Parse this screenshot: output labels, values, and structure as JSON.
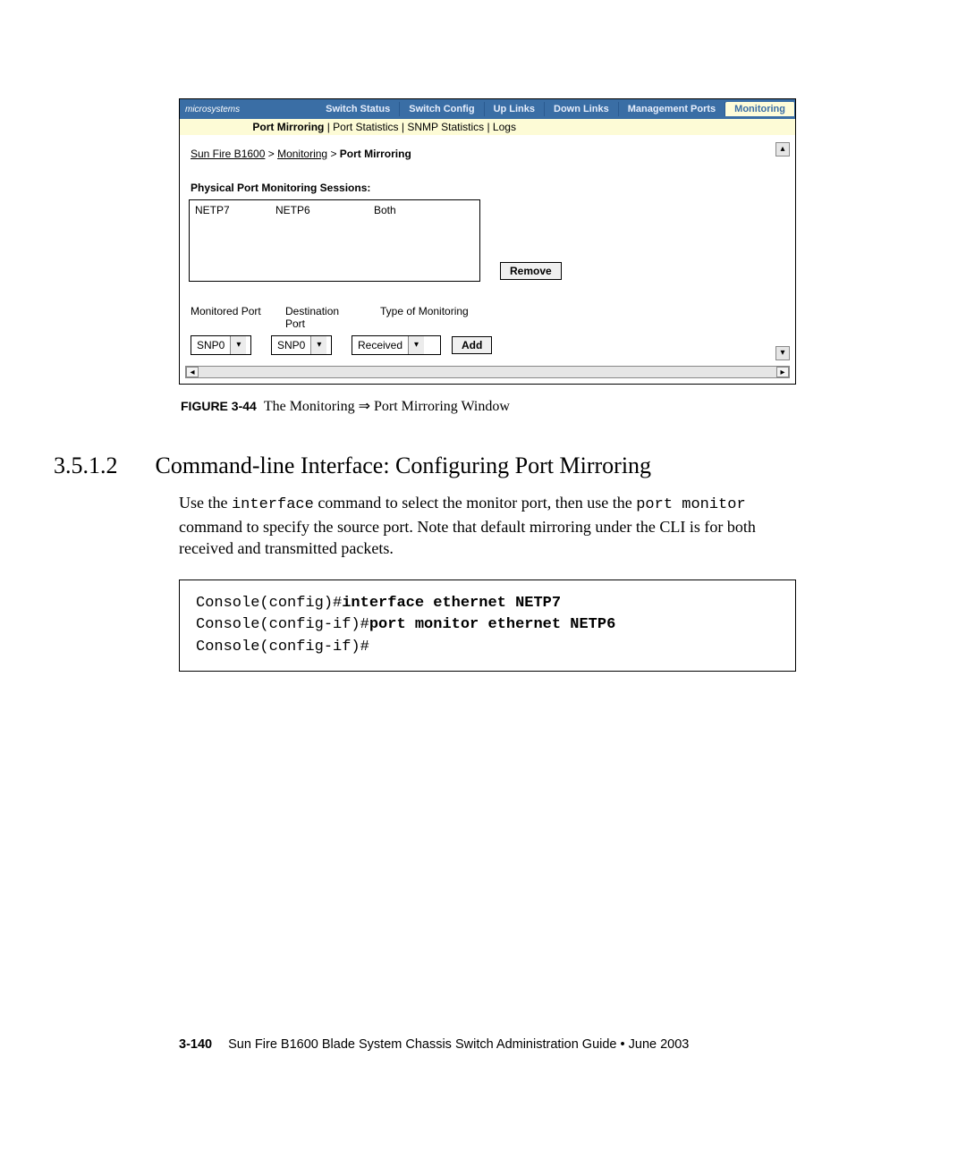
{
  "screenshot": {
    "logo": "microsystems",
    "tabs": [
      "Switch Status",
      "Switch Config",
      "Up Links",
      "Down Links",
      "Management Ports",
      "Monitoring"
    ],
    "activeTabIndex": 5,
    "subtabs": {
      "active": "Port Mirroring",
      "rest": [
        "Port Statistics",
        "SNMP Statistics",
        "Logs"
      ]
    },
    "breadcrumbs": {
      "root": "Sun Fire B1600",
      "mid": "Monitoring",
      "leaf": "Port Mirroring"
    },
    "sessions_label": "Physical Port Monitoring Sessions:",
    "session_row": {
      "c1": "NETP7",
      "c2": "NETP6",
      "c3": "Both"
    },
    "remove_label": "Remove",
    "labels": {
      "a": "Monitored Port",
      "b": "Destination Port",
      "c": "Type of Monitoring"
    },
    "selects": {
      "monitored": "SNP0",
      "destination": "SNP0",
      "type": "Received"
    },
    "add_label": "Add"
  },
  "caption": {
    "fig": "FIGURE 3-44",
    "text_prefix": "The Monitoring ",
    "arrow": "⇒",
    "text_suffix": " Port Mirroring Window"
  },
  "section": {
    "num": "3.5.1.2",
    "title": "Command-line Interface: Configuring Port Mirroring"
  },
  "para": {
    "t1": "Use the ",
    "c1": "interface",
    "t2": " command to select the monitor port, then use the ",
    "c2": "port monitor",
    "t3": " command to specify the source port. Note that default mirroring under the CLI is for both received and transmitted packets."
  },
  "code": {
    "l1a": "Console(config)#",
    "l1b": "interface ethernet NETP7",
    "l2a": "Console(config-if)#",
    "l2b": "port monitor ethernet NETP6",
    "l3": "Console(config-if)#"
  },
  "footer": {
    "page": "3-140",
    "text": "Sun Fire B1600 Blade System Chassis Switch Administration Guide • June 2003"
  }
}
